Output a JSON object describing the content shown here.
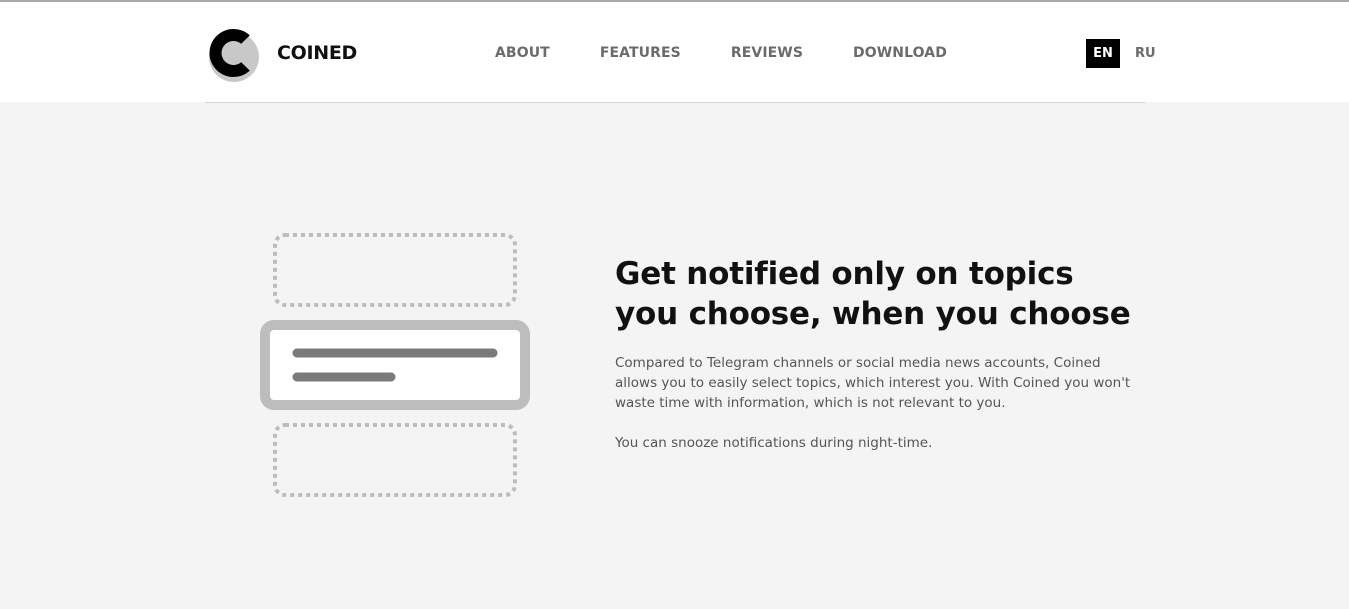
{
  "brand": {
    "name": "COINED",
    "logo_icon": "coined-c-logo-icon",
    "colors": {
      "accent": "#000000",
      "header_bg": "#ffffff",
      "section_bg": "#f4f4f4",
      "nav_text": "#6b6b6b",
      "illustration_gray": "#bdbdbd",
      "illustration_dark": "#7a7a7a"
    }
  },
  "nav": {
    "items": [
      {
        "label": "ABOUT"
      },
      {
        "label": "FEATURES"
      },
      {
        "label": "REVIEWS"
      },
      {
        "label": "DOWNLOAD"
      }
    ]
  },
  "language": {
    "options": [
      {
        "label": "EN",
        "active": true
      },
      {
        "label": "RU",
        "active": false
      }
    ]
  },
  "feature": {
    "icon": "notification-cards-illustration",
    "title": "Get notified only on topics you choose, when you choose",
    "paragraphs": [
      "Compared to Telegram channels or social media news accounts, Coined allows you to easily select topics, which interest you. With Coined you won't waste time with information, which is not relevant to you.",
      "You can snooze notifications during night-time."
    ]
  }
}
